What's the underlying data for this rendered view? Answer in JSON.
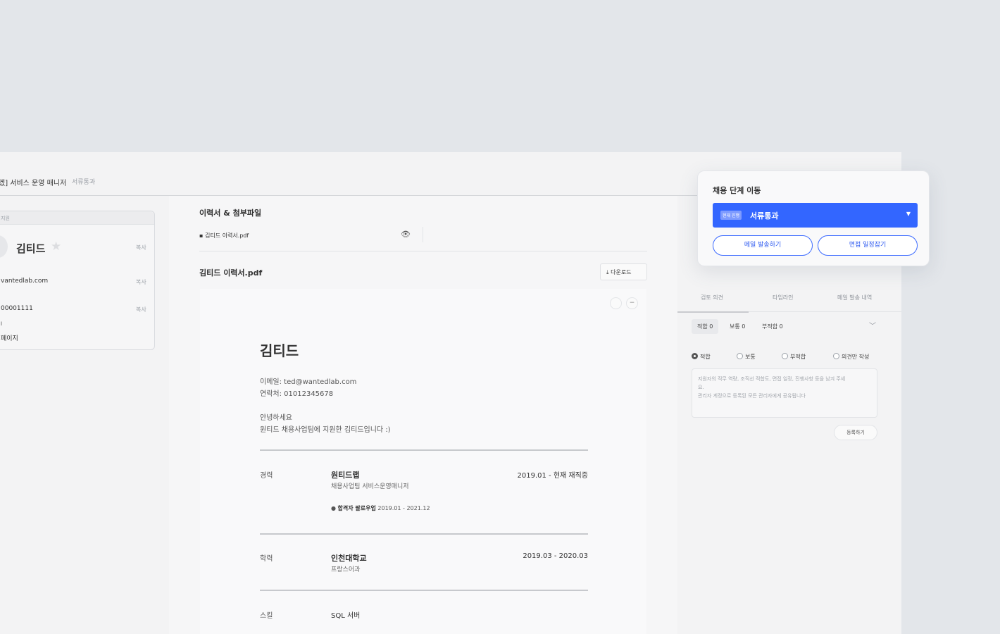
{
  "topbar": {
    "title": "겠] 서비스 운영 매니저",
    "stage": "서류통과"
  },
  "candidate": {
    "header": "지원",
    "name": "김티드",
    "email": "vantedlab.com",
    "phone": "00001111",
    "extra1": "l",
    "extra2": "페이지",
    "copy_label": "복사"
  },
  "attachments": {
    "section_title": "이력서 & 첨부파일",
    "file_name": "김티드 이력서.pdf",
    "viewer_title": "김티드 이력서.pdf",
    "download_label": "다운로드"
  },
  "resume": {
    "name": "김티드",
    "email": "이메일: ted@wantedlab.com",
    "phone": "연락처: 01012345678",
    "greeting1": "안녕하세요",
    "greeting2": "원티드 채용사업팀에 지원한 김티드입니다 :)",
    "career": {
      "label": "경력",
      "company": "원티드랩",
      "role": "채용사업팀 서비스운영매니저",
      "period": "2019.01 - 현재 재직중",
      "project_name": "합격자 팔로우업",
      "project_period": "2019.01 - 2021.12"
    },
    "education": {
      "label": "학력",
      "school": "인천대학교",
      "major": "프랑스어과",
      "period": "2019.03 - 2020.03"
    },
    "skills": {
      "label": "스킬",
      "value": "SQL 서버"
    }
  },
  "review": {
    "tabs": [
      "검토 의견",
      "타임라인",
      "메일 발송 내역"
    ],
    "chips": [
      "적합 0",
      "보통 0",
      "부적합 0"
    ],
    "radios": [
      "적합",
      "보통",
      "부적합",
      "의견만 작성"
    ],
    "placeholder_line1": "지원자의 직무 역량, 조직선 적합도, 면접 일정, 진행사항 등을 남겨 주세",
    "placeholder_line2": "요.",
    "placeholder_line3": "관리자 계정으로 등록된 모든 관리자에게 공유됩니다",
    "submit_label": "등록하기"
  },
  "popover": {
    "title": "채용 단계 이동",
    "badge": "현재 진행",
    "selected_stage": "서류통과",
    "email_button": "메일 발송하기",
    "schedule_button": "면접 일정잡기"
  },
  "colors": {
    "primary": "#3366ff",
    "background": "#e3e6ea"
  }
}
